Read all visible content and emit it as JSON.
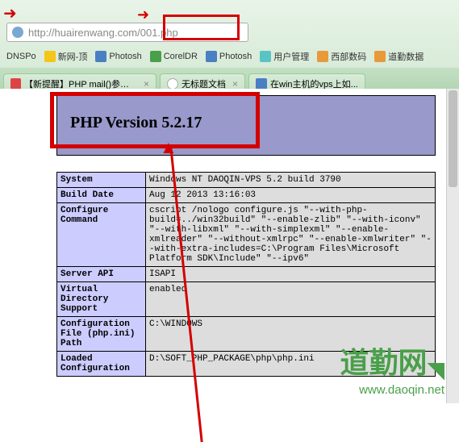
{
  "url": "http://huairenwang.com/001.php",
  "bookmarks": [
    {
      "label": "DNSPo"
    },
    {
      "label": "新网-顶"
    },
    {
      "label": "Photosh"
    },
    {
      "label": "CorelDR"
    },
    {
      "label": "Photosh"
    },
    {
      "label": "用户管理"
    },
    {
      "label": "西部数码"
    },
    {
      "label": "道勤数据"
    }
  ],
  "tabs": [
    {
      "title": "【新提醒】PHP mail()参数设..."
    },
    {
      "title": "无标题文档"
    },
    {
      "title": "在win主机的vps上如..."
    }
  ],
  "php_version_label": "PHP Version 5.2.17",
  "info_rows": [
    {
      "key": "System",
      "val": "Windows NT DAOQIN-VPS 5.2 build 3790"
    },
    {
      "key": "Build Date",
      "val": "Aug 12 2013 13:16:03"
    },
    {
      "key": "Configure Command",
      "val": "cscript /nologo configure.js \"--with-php-build=../win32build\" \"--enable-zlib\" \"--with-iconv\" \"--with-libxml\" \"--with-simplexml\" \"--enable-xmlreader\" \"--without-xmlrpc\" \"--enable-xmlwriter\" \"--with-extra-includes=C:\\Program Files\\Microsoft Platform SDK\\Include\" \"--ipv6\""
    },
    {
      "key": "Server API",
      "val": "ISAPI"
    },
    {
      "key": "Virtual Directory Support",
      "val": "enabled"
    },
    {
      "key": "Configuration File (php.ini) Path",
      "val": "C:\\WINDOWS"
    },
    {
      "key": "Loaded Configuration",
      "val": "D:\\SOFT_PHP_PACKAGE\\php\\php.ini"
    }
  ],
  "watermark": {
    "text": "道勤网",
    "url": "www.daoqin.net"
  }
}
